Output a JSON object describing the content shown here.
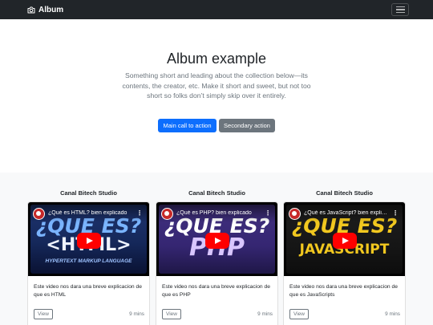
{
  "navbar": {
    "brand_icon": "camera-icon",
    "brand": "Album",
    "toggler_icon": "hamburger-menu-icon"
  },
  "hero": {
    "title": "Album example",
    "lead": "Something short and leading about the collection below—its contents, the creator, etc. Make it short and sweet, but not too short so folks don’t simply skip over it entirely.",
    "primary_cta": "Main call to action",
    "secondary_cta": "Secondary action"
  },
  "cards": [
    {
      "channel": "Canal Bitech Studio",
      "video_title": "¿Qué es HTML? bien explicado",
      "thumb_line1": "¿QUE ES?",
      "thumb_line2": "<HTML>",
      "thumb_sub": "HYPERTEXT MARKUP LANGUAGE",
      "description": "Este video nos dara una breve explicacion de que es HTML",
      "view": "View",
      "duration": "9 mins"
    },
    {
      "channel": "Canal Bitech Studio",
      "video_title": "¿Qué es PHP? bien explicado",
      "thumb_line1": "¿QUE ES?",
      "thumb_line2": "PHP",
      "thumb_sub": "",
      "description": "Este video nos dara una breve explicacion de que es PHP",
      "view": "View",
      "duration": "9 mins"
    },
    {
      "channel": "Canal Bitech Studio",
      "video_title": "¿Qué es JavaScript? bien explicado",
      "thumb_line1": "¿QUE ES?",
      "thumb_line2": "JAVASCRIPT",
      "thumb_sub": "",
      "description": "Este video nos dara una breve explicacion de que es JavaScripts",
      "view": "View",
      "duration": "9 mins"
    }
  ],
  "colors": {
    "navbar_bg": "#212529",
    "primary": "#0d6efd",
    "secondary": "#6c757d",
    "album_bg": "#f8f9fa",
    "play_red": "#ff0000"
  }
}
